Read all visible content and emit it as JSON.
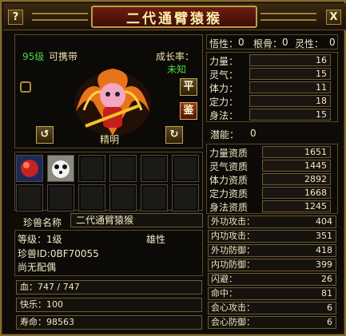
{
  "window": {
    "title": "二代通臂猿猴",
    "help_button": "?",
    "close_button": "X"
  },
  "portrait": {
    "level_text": "95级",
    "carry_text": "可携带",
    "growth_label": "成长率：",
    "growth_value": "未知",
    "personality": "精明",
    "btn_ping": "平",
    "btn_jian": "鉴"
  },
  "aptitudes_top": {
    "wuxing_label": "悟性：",
    "wuxing_value": "0",
    "gengu_label": "根骨：",
    "gengu_value": "0",
    "lingxing_label": "灵性：",
    "lingxing_value": "0"
  },
  "attributes": [
    {
      "label": "力量：",
      "value": "16"
    },
    {
      "label": "灵气：",
      "value": "15"
    },
    {
      "label": "体力：",
      "value": "11"
    },
    {
      "label": "定力：",
      "value": "18"
    },
    {
      "label": "身法：",
      "value": "15"
    }
  ],
  "potential": {
    "label": "潜能：",
    "value": "0"
  },
  "qualities": [
    {
      "label": "力量资质",
      "value": "1651"
    },
    {
      "label": "灵气资质",
      "value": "1445"
    },
    {
      "label": "体力资质",
      "value": "2892"
    },
    {
      "label": "定力资质",
      "value": "1668"
    },
    {
      "label": "身法资质",
      "value": "1245"
    }
  ],
  "combat": [
    {
      "label": "外功攻击：",
      "value": "404"
    },
    {
      "label": "内功攻击：",
      "value": "351"
    },
    {
      "label": "外功防御：",
      "value": "418"
    },
    {
      "label": "内功防御：",
      "value": "399"
    },
    {
      "label": "闪避：",
      "value": "26"
    },
    {
      "label": "命中：",
      "value": "81"
    },
    {
      "label": "会心攻击：",
      "value": "6"
    },
    {
      "label": "会心防御：",
      "value": "6"
    }
  ],
  "pet_name": {
    "label": "珍兽名称",
    "value": "二代通臂猿猴"
  },
  "info": {
    "level": "等级：1级",
    "gender": "雄性",
    "id": "珍兽ID:0BF70055",
    "spouse": "尚无配偶"
  },
  "bottom": {
    "hp": "血：747 / 747",
    "happiness": "快乐：100",
    "lifespan": "寿命：98563"
  },
  "colors": {
    "accent_gold": "#c59a3f",
    "title_red": "#6b1e10",
    "growth_green": "#4bd74b"
  }
}
